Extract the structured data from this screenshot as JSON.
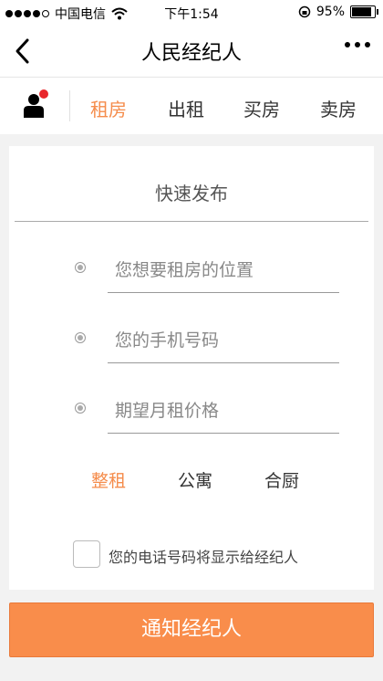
{
  "status_bar": {
    "carrier": "中国电信",
    "time": "下午1:54",
    "battery": "95%"
  },
  "nav": {
    "title": "人民经纪人",
    "back_icon": "chevron-left-icon",
    "more_icon": "more-horizontal-icon"
  },
  "tabs": [
    {
      "label": "租房",
      "active": true
    },
    {
      "label": "出租",
      "active": false
    },
    {
      "label": "买房",
      "active": false
    },
    {
      "label": "卖房",
      "active": false
    }
  ],
  "form": {
    "title": "快速发布",
    "fields": [
      {
        "placeholder": "您想要租房的位置",
        "value": ""
      },
      {
        "placeholder": "您的手机号码",
        "value": ""
      },
      {
        "placeholder": "期望月租价格",
        "value": ""
      }
    ],
    "rent_types": [
      {
        "label": "整租",
        "active": true
      },
      {
        "label": "公寓",
        "active": false
      },
      {
        "label": "合厨",
        "active": false
      }
    ],
    "consent_label": "您的电话号码将显示给经纪人",
    "consent_checked": false
  },
  "submit_label": "通知经纪人",
  "colors": {
    "accent": "#f58c4b",
    "button": "#f98d4b",
    "notification_dot": "#e8262b"
  }
}
